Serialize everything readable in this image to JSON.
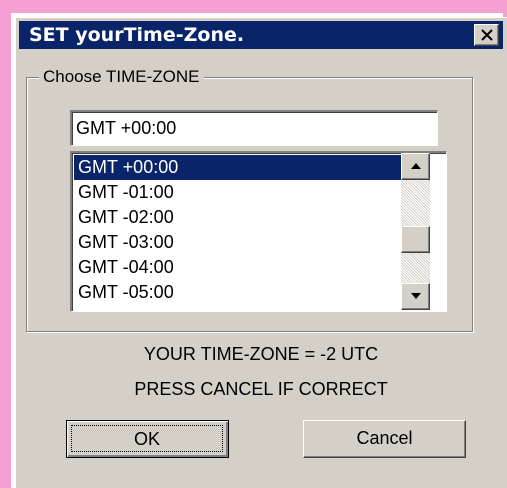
{
  "window": {
    "title": "SET yourTime-Zone.",
    "close_icon": "close-x-icon"
  },
  "group": {
    "label": "Choose TIME-ZONE"
  },
  "timezone_field": {
    "value": "GMT +00:00"
  },
  "timezone_list": {
    "selected_index": 0,
    "items": [
      "GMT +00:00",
      "GMT -01:00",
      "GMT -02:00",
      "GMT -03:00",
      "GMT -04:00",
      "GMT -05:00"
    ],
    "scroll_up_icon": "arrow-up-icon",
    "scroll_down_icon": "arrow-down-icon"
  },
  "status": {
    "line1": "YOUR TIME-ZONE = -2 UTC",
    "line2": "PRESS CANCEL IF CORRECT"
  },
  "buttons": {
    "ok": "OK",
    "cancel": "Cancel"
  },
  "colors": {
    "titlebar": "#0a246a",
    "selection": "#0a246a",
    "face": "#d4d0c8",
    "page_frame": "#f4a0d2"
  }
}
